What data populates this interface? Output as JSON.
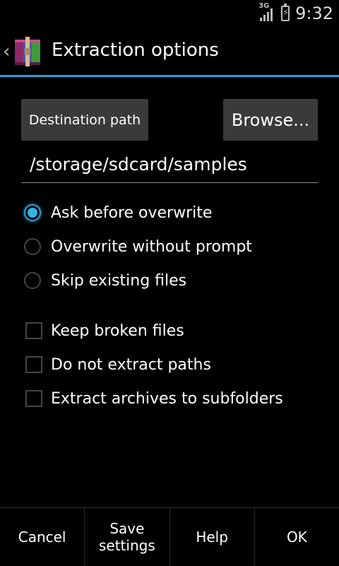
{
  "status_bar": {
    "network": "3G",
    "time": "9:32"
  },
  "action_bar": {
    "title": "Extraction options"
  },
  "destination": {
    "button_label": "Destination path",
    "browse_label": "Browse...",
    "path": "/storage/sdcard/samples"
  },
  "overwrite_options": [
    {
      "label": "Ask before overwrite",
      "selected": true
    },
    {
      "label": "Overwrite without prompt",
      "selected": false
    },
    {
      "label": "Skip existing files",
      "selected": false
    }
  ],
  "checkbox_options": [
    {
      "label": "Keep broken files",
      "checked": false
    },
    {
      "label": "Do not extract paths",
      "checked": false
    },
    {
      "label": "Extract archives to subfolders",
      "checked": false
    }
  ],
  "bottom_bar": {
    "cancel": "Cancel",
    "save": "Save\nsettings",
    "help": "Help",
    "ok": "OK"
  },
  "colors": {
    "accent": "#33b5e5",
    "background": "#000000",
    "button": "#3a3a3a"
  }
}
